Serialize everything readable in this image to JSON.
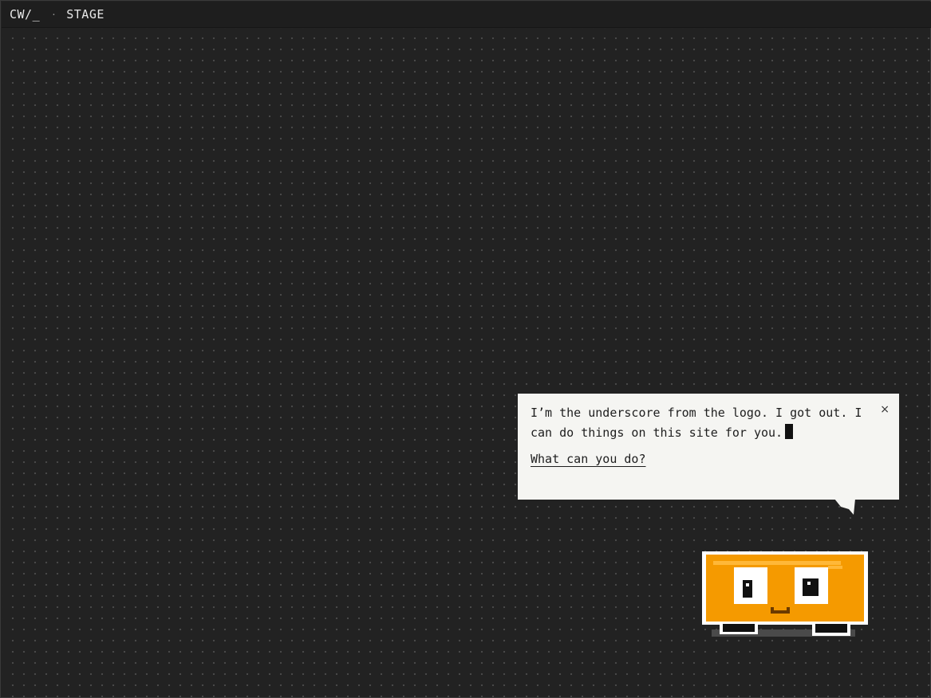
{
  "topbar": {
    "brand": "CW/_",
    "separator": "·",
    "section": "STAGE"
  },
  "bubble": {
    "message": "I’m the underscore from the logo. I got out. I can do things on this site for you.",
    "link_label": "What can you do?",
    "close_label": "×"
  },
  "mascot": {
    "name": "underscore-mascot",
    "body_color": "#f59a00",
    "highlight_color": "#ffb838",
    "outline_color": "#ffffff"
  },
  "colors": {
    "background": "#222222",
    "dot": "#4a4a4a",
    "bubble_bg": "#f5f5f2",
    "text": "#1e1e1e"
  }
}
